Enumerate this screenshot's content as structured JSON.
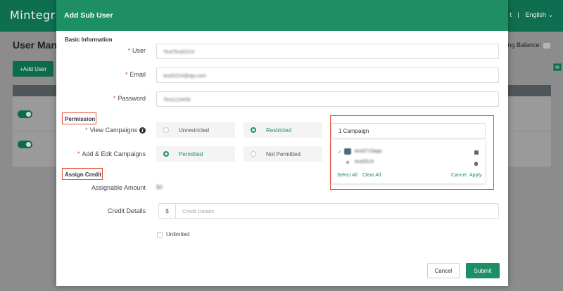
{
  "background": {
    "logo": "Mintegra",
    "top_right": {
      "partial": "t",
      "language": "English"
    },
    "page_title": "User Mana",
    "balance_label": "sing Balance:",
    "add_button": "+Add User"
  },
  "modal": {
    "title": "Add Sub User",
    "sections": {
      "basic": "Basic Information",
      "permission": "Permission",
      "credit": "Assign Credit"
    },
    "fields": {
      "user": {
        "label": "User",
        "value": "TestTest0224"
      },
      "email": {
        "label": "Email",
        "value": "test0224@qq.com"
      },
      "password": {
        "label": "Password",
        "value": "Test123456"
      }
    },
    "view_campaigns": {
      "label": "View Campaigns",
      "options": [
        "Unrestricted",
        "Restricted"
      ],
      "selected": "Restricted",
      "select_value": "1 Campaign"
    },
    "add_edit_campaigns": {
      "label": "Add & Edit Campaigns",
      "options": [
        "Permitted",
        "Not Permitted"
      ],
      "selected": "Permitted"
    },
    "campaign_dropdown": {
      "items": [
        {
          "name": "test0715app",
          "checked": true,
          "platform_icon": "android-icon"
        },
        {
          "name": "test0519",
          "checked": false,
          "platform_icon": "apple-icon"
        }
      ],
      "select_all": "Select All",
      "clear_all": "Clear All",
      "cancel": "Cancel",
      "apply": "Apply"
    },
    "assignable_amount": {
      "label": "Assignable Amount",
      "value": "$0"
    },
    "credit_details": {
      "label": "Credit Details",
      "prefix": "$",
      "placeholder": "Credit Details"
    },
    "unlimited_label": "Unlimited",
    "buttons": {
      "cancel": "Cancel",
      "submit": "Submit"
    }
  },
  "colors": {
    "brand_green": "#1e8f64",
    "highlight_red": "#e0503c",
    "required_red": "#e0403a"
  }
}
